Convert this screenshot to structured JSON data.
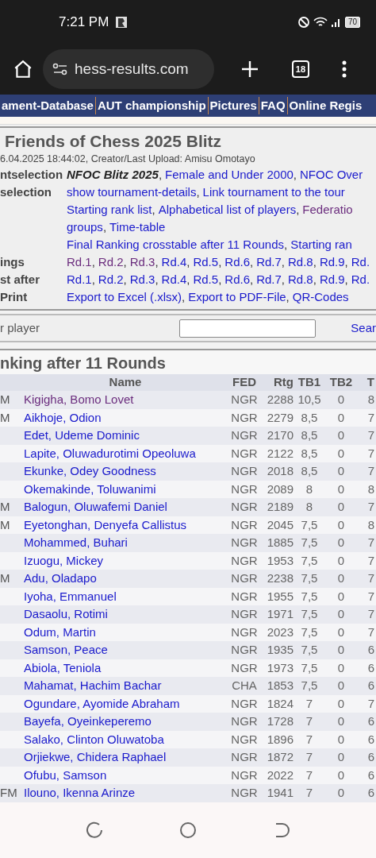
{
  "status_bar": {
    "time": "7:21 PM",
    "battery": "70"
  },
  "browser": {
    "url": "hess-results.com",
    "tab_count": "18"
  },
  "nav": [
    "ament-Database",
    "AUT championship",
    "Pictures",
    "FAQ",
    "Online Regis"
  ],
  "tournament": {
    "title": "Friends of Chess 2025 Blitz",
    "updated": "6.04.2025 18:44:02, Creator/Last Upload: Amisu Omotayo",
    "rows": [
      {
        "label": "ntselection",
        "links": [
          {
            "text": "NFOC Blitz 2025",
            "kind": "current"
          },
          {
            "text": "Female and Under 2000",
            "kind": "link",
            "visited": false
          },
          {
            "text": "NFOC Over",
            "kind": "link",
            "visited": false
          }
        ]
      },
      {
        "label": "selection",
        "links": [
          {
            "text": "show tournament-details",
            "kind": "link",
            "visited": false
          },
          {
            "text": "Link tournament to the tour",
            "kind": "link",
            "visited": false
          }
        ]
      },
      {
        "links": [
          {
            "text": "Starting rank list",
            "kind": "link",
            "visited": false
          },
          {
            "text": "Alphabetical list of players",
            "kind": "link",
            "visited": false
          },
          {
            "text": "Federatio",
            "kind": "link",
            "visited": true
          }
        ]
      },
      {
        "links": [
          {
            "text": "groups",
            "kind": "link",
            "visited": false
          },
          {
            "text": "Time-table",
            "kind": "link",
            "visited": false
          }
        ]
      },
      {
        "links": [
          {
            "text": "Final Ranking crosstable after 11 Rounds",
            "kind": "link",
            "visited": false
          },
          {
            "text": "Starting ran",
            "kind": "link",
            "visited": false
          }
        ]
      },
      {
        "label": "ings",
        "links": [
          {
            "text": "Rd.1",
            "kind": "link",
            "visited": true
          },
          {
            "text": "Rd.2",
            "kind": "link",
            "visited": true
          },
          {
            "text": "Rd.3",
            "kind": "link",
            "visited": true
          },
          {
            "text": "Rd.4",
            "kind": "link",
            "visited": false
          },
          {
            "text": "Rd.5",
            "kind": "link",
            "visited": false
          },
          {
            "text": "Rd.6",
            "kind": "link",
            "visited": false
          },
          {
            "text": "Rd.7",
            "kind": "link",
            "visited": false
          },
          {
            "text": "Rd.8",
            "kind": "link",
            "visited": false
          },
          {
            "text": "Rd.9",
            "kind": "link",
            "visited": false
          },
          {
            "text": "Rd.",
            "kind": "link",
            "visited": false
          }
        ]
      },
      {
        "label": "st after",
        "links": [
          {
            "text": "Rd.1",
            "kind": "link",
            "visited": false
          },
          {
            "text": "Rd.2",
            "kind": "link",
            "visited": false
          },
          {
            "text": "Rd.3",
            "kind": "link",
            "visited": false
          },
          {
            "text": "Rd.4",
            "kind": "link",
            "visited": false
          },
          {
            "text": "Rd.5",
            "kind": "link",
            "visited": false
          },
          {
            "text": "Rd.6",
            "kind": "link",
            "visited": false
          },
          {
            "text": "Rd.7",
            "kind": "link",
            "visited": false
          },
          {
            "text": "Rd.8",
            "kind": "link",
            "visited": false
          },
          {
            "text": "Rd.9",
            "kind": "link",
            "visited": false
          },
          {
            "text": "Rd.",
            "kind": "link",
            "visited": false
          }
        ]
      },
      {
        "label": "Print",
        "links": [
          {
            "text": "Export to Excel (.xlsx)",
            "kind": "link",
            "visited": false
          },
          {
            "text": "Export to PDF-File",
            "kind": "link",
            "visited": false
          },
          {
            "text": "QR-Codes",
            "kind": "link",
            "visited": false
          }
        ]
      }
    ],
    "separator": ","
  },
  "search": {
    "label": "r player",
    "button": "Sear"
  },
  "ranking": {
    "title": "nking after 11 Rounds",
    "columns": [
      "Name",
      "FED",
      "Rtg",
      "TB1",
      "TB2",
      "T"
    ],
    "rows": [
      {
        "title": "M",
        "name": "Kigigha, Bomo Lovet",
        "visited": true,
        "fed": "NGR",
        "rtg": "2288",
        "tb1": "10,5",
        "tb2": "0",
        "tb3": "8"
      },
      {
        "title": "M",
        "name": "Aikhoje, Odion",
        "visited": false,
        "fed": "NGR",
        "rtg": "2279",
        "tb1": "8,5",
        "tb2": "0",
        "tb3": "7"
      },
      {
        "name": "Edet, Udeme Dominic",
        "visited": false,
        "fed": "NGR",
        "rtg": "2170",
        "tb1": "8,5",
        "tb2": "0",
        "tb3": "7"
      },
      {
        "name": "Lapite, Oluwadurotimi Opeoluwa",
        "visited": false,
        "fed": "NGR",
        "rtg": "2122",
        "tb1": "8,5",
        "tb2": "0",
        "tb3": "7"
      },
      {
        "name": "Ekunke, Odey Goodness",
        "visited": false,
        "fed": "NGR",
        "rtg": "2018",
        "tb1": "8,5",
        "tb2": "0",
        "tb3": "7"
      },
      {
        "name": "Okemakinde, Toluwanimi",
        "visited": false,
        "fed": "NGR",
        "rtg": "2089",
        "tb1": "8",
        "tb2": "0",
        "tb3": "8"
      },
      {
        "title": "M",
        "name": "Balogun, Oluwafemi Daniel",
        "visited": false,
        "fed": "NGR",
        "rtg": "2189",
        "tb1": "8",
        "tb2": "0",
        "tb3": "7"
      },
      {
        "title": "M",
        "name": "Eyetonghan, Denyefa Callistus",
        "visited": false,
        "fed": "NGR",
        "rtg": "2045",
        "tb1": "7,5",
        "tb2": "0",
        "tb3": "8"
      },
      {
        "name": "Mohammed, Buhari",
        "visited": false,
        "fed": "NGR",
        "rtg": "1885",
        "tb1": "7,5",
        "tb2": "0",
        "tb3": "7"
      },
      {
        "name": "Izuogu, Mickey",
        "visited": false,
        "fed": "NGR",
        "rtg": "1953",
        "tb1": "7,5",
        "tb2": "0",
        "tb3": "7"
      },
      {
        "title": "M",
        "name": "Adu, Oladapo",
        "visited": false,
        "fed": "NGR",
        "rtg": "2238",
        "tb1": "7,5",
        "tb2": "0",
        "tb3": "7"
      },
      {
        "name": "Iyoha, Emmanuel",
        "visited": false,
        "fed": "NGR",
        "rtg": "1955",
        "tb1": "7,5",
        "tb2": "0",
        "tb3": "7"
      },
      {
        "name": "Dasaolu, Rotimi",
        "visited": false,
        "fed": "NGR",
        "rtg": "1971",
        "tb1": "7,5",
        "tb2": "0",
        "tb3": "7"
      },
      {
        "name": "Odum, Martin",
        "visited": false,
        "fed": "NGR",
        "rtg": "2023",
        "tb1": "7,5",
        "tb2": "0",
        "tb3": "7"
      },
      {
        "name": "Samson, Peace",
        "visited": false,
        "fed": "NGR",
        "rtg": "1935",
        "tb1": "7,5",
        "tb2": "0",
        "tb3": "6"
      },
      {
        "name": "Abiola, Teniola",
        "visited": false,
        "fed": "NGR",
        "rtg": "1973",
        "tb1": "7,5",
        "tb2": "0",
        "tb3": "6"
      },
      {
        "name": "Mahamat, Hachim Bachar",
        "visited": false,
        "fed": "CHA",
        "rtg": "1853",
        "tb1": "7,5",
        "tb2": "0",
        "tb3": "6"
      },
      {
        "name": "Ogundare, Ayomide Abraham",
        "visited": false,
        "fed": "NGR",
        "rtg": "1824",
        "tb1": "7",
        "tb2": "0",
        "tb3": "7"
      },
      {
        "name": "Bayefa, Oyeinkeperemo",
        "visited": false,
        "fed": "NGR",
        "rtg": "1728",
        "tb1": "7",
        "tb2": "0",
        "tb3": "6"
      },
      {
        "name": "Salako, Clinton Oluwatoba",
        "visited": false,
        "fed": "NGR",
        "rtg": "1896",
        "tb1": "7",
        "tb2": "0",
        "tb3": "6"
      },
      {
        "name": "Orjiekwe, Chidera Raphael",
        "visited": false,
        "fed": "NGR",
        "rtg": "1872",
        "tb1": "7",
        "tb2": "0",
        "tb3": "6"
      },
      {
        "name": "Ofubu, Samson",
        "visited": false,
        "fed": "NGR",
        "rtg": "2022",
        "tb1": "7",
        "tb2": "0",
        "tb3": "6"
      },
      {
        "title": "FM",
        "name": "Ilouno, Ikenna Arinze",
        "visited": false,
        "fed": "NGR",
        "rtg": "1941",
        "tb1": "7",
        "tb2": "0",
        "tb3": "6"
      }
    ]
  }
}
